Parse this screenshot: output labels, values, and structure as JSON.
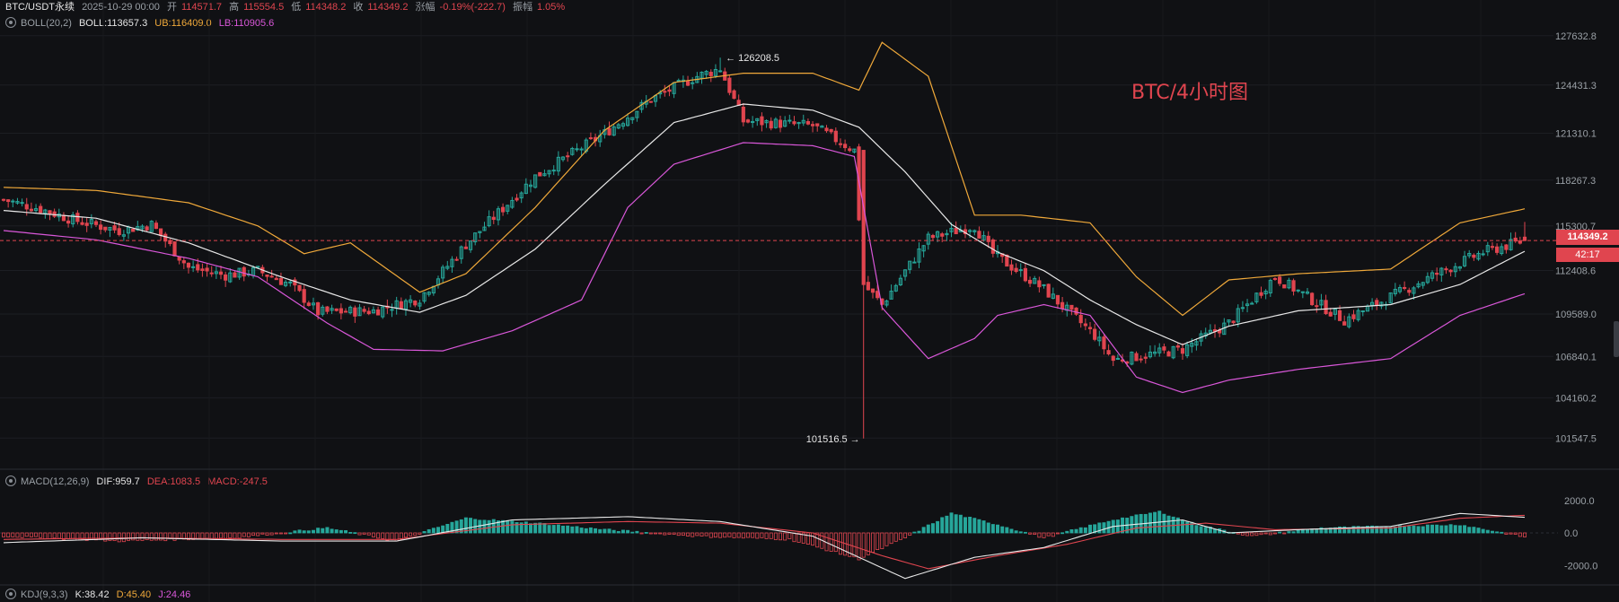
{
  "header": {
    "symbol": "BTC/USDT永续",
    "date": "2025-10-29 00:00",
    "open_label": "开",
    "open": "114571.7",
    "high_label": "高",
    "high": "115554.5",
    "low_label": "低",
    "low": "114348.2",
    "close_label": "收",
    "close": "114349.2",
    "change_label": "涨幅",
    "change": "-0.19%(-222.7)",
    "amp_label": "振幅",
    "amp": "1.05%"
  },
  "boll": {
    "name": "BOLL(20,2)",
    "mid": "BOLL:113657.3",
    "ub": "UB:116409.0",
    "lb": "LB:110905.6"
  },
  "macd": {
    "name": "MACD(12,26,9)",
    "dif": "DIF:959.7",
    "dea": "DEA:1083.5",
    "macd": "MACD:-247.5"
  },
  "kdj": {
    "name": "KDJ(9,3,3)",
    "k": "K:38.42",
    "d": "D:45.40",
    "j": "J:24.46"
  },
  "colors": {
    "up": "#26a69a",
    "down": "#e0454f",
    "mid": "#e8e8e8",
    "ub": "#f0a93a",
    "lb": "#d957d9",
    "dea": "#e0454f",
    "dif": "#e8e8e8"
  },
  "watermark": "BTC/4小时图",
  "current_price": "114349.2",
  "countdown": "42:17",
  "chart_data": [
    {
      "type": "candlestick",
      "ylim": [
        100400,
        128200
      ],
      "yticks": [
        "127632.8",
        "124431.3",
        "121310.1",
        "118267.3",
        "115300.7",
        "112408.6",
        "109589.0",
        "106840.1",
        "104160.2",
        "101547.5"
      ],
      "ytick_values": [
        127632.8,
        124431.3,
        121310.1,
        118267.3,
        115300.7,
        112408.6,
        109589.0,
        106840.1,
        104160.2,
        101547.5
      ],
      "annotations": [
        {
          "text": "126208.5",
          "value": 126208.5,
          "bar": 155
        },
        {
          "text": "101516.5",
          "value": 101516.5,
          "bar": 186
        }
      ],
      "bars": 330,
      "close_anchors": [
        [
          0,
          117000
        ],
        [
          8,
          116400
        ],
        [
          15,
          115700
        ],
        [
          25,
          115000
        ],
        [
          32,
          115400
        ],
        [
          40,
          112600
        ],
        [
          48,
          112100
        ],
        [
          55,
          112400
        ],
        [
          62,
          111500
        ],
        [
          68,
          109700
        ],
        [
          80,
          109800
        ],
        [
          90,
          110600
        ],
        [
          100,
          114100
        ],
        [
          115,
          118500
        ],
        [
          130,
          121300
        ],
        [
          140,
          123500
        ],
        [
          150,
          125000
        ],
        [
          155,
          125500
        ],
        [
          160,
          122100
        ],
        [
          175,
          121800
        ],
        [
          184,
          120200
        ],
        [
          186,
          111500
        ],
        [
          190,
          110200
        ],
        [
          200,
          114500
        ],
        [
          210,
          115300
        ],
        [
          214,
          113500
        ],
        [
          225,
          111200
        ],
        [
          236,
          108200
        ],
        [
          240,
          106600
        ],
        [
          255,
          107300
        ],
        [
          265,
          109000
        ],
        [
          275,
          112000
        ],
        [
          290,
          109200
        ],
        [
          310,
          112200
        ],
        [
          320,
          113600
        ],
        [
          329,
          114349.2
        ]
      ],
      "boll_mid_anchors": [
        [
          0,
          116300
        ],
        [
          20,
          115800
        ],
        [
          40,
          114200
        ],
        [
          60,
          112000
        ],
        [
          75,
          110500
        ],
        [
          90,
          109700
        ],
        [
          100,
          110800
        ],
        [
          115,
          113800
        ],
        [
          130,
          118000
        ],
        [
          145,
          122000
        ],
        [
          160,
          123200
        ],
        [
          175,
          122800
        ],
        [
          185,
          121700
        ],
        [
          195,
          118800
        ],
        [
          205,
          115400
        ],
        [
          215,
          113600
        ],
        [
          225,
          112400
        ],
        [
          235,
          110500
        ],
        [
          245,
          108900
        ],
        [
          255,
          107600
        ],
        [
          265,
          108800
        ],
        [
          280,
          109800
        ],
        [
          300,
          110200
        ],
        [
          315,
          111500
        ],
        [
          329,
          113657.3
        ]
      ],
      "boll_ub_anchors": [
        [
          0,
          117800
        ],
        [
          20,
          117600
        ],
        [
          40,
          116800
        ],
        [
          55,
          115300
        ],
        [
          65,
          113500
        ],
        [
          75,
          114200
        ],
        [
          90,
          111000
        ],
        [
          100,
          112200
        ],
        [
          115,
          116500
        ],
        [
          130,
          121500
        ],
        [
          145,
          124600
        ],
        [
          160,
          125200
        ],
        [
          175,
          125200
        ],
        [
          185,
          124100
        ],
        [
          190,
          127200
        ],
        [
          200,
          125000
        ],
        [
          210,
          116000
        ],
        [
          220,
          116000
        ],
        [
          235,
          115500
        ],
        [
          245,
          112000
        ],
        [
          255,
          109500
        ],
        [
          265,
          111800
        ],
        [
          280,
          112200
        ],
        [
          300,
          112500
        ],
        [
          315,
          115500
        ],
        [
          329,
          116409.0
        ]
      ],
      "boll_lb_anchors": [
        [
          0,
          115000
        ],
        [
          20,
          114400
        ],
        [
          40,
          113200
        ],
        [
          55,
          112000
        ],
        [
          70,
          109000
        ],
        [
          80,
          107300
        ],
        [
          95,
          107200
        ],
        [
          110,
          108500
        ],
        [
          125,
          110500
        ],
        [
          135,
          116500
        ],
        [
          145,
          119300
        ],
        [
          160,
          120700
        ],
        [
          175,
          120500
        ],
        [
          184,
          119800
        ],
        [
          190,
          110000
        ],
        [
          200,
          106700
        ],
        [
          210,
          108000
        ],
        [
          215,
          109500
        ],
        [
          225,
          110200
        ],
        [
          235,
          109500
        ],
        [
          245,
          105500
        ],
        [
          255,
          104500
        ],
        [
          265,
          105300
        ],
        [
          280,
          106000
        ],
        [
          300,
          106700
        ],
        [
          315,
          109500
        ],
        [
          329,
          110905.6
        ]
      ]
    },
    {
      "type": "bar",
      "name": "MACD(12,26,9)",
      "ylim": [
        -3200,
        3200
      ],
      "yticks": [
        "2000.0",
        "0.0",
        "-2000.0"
      ],
      "ytick_values": [
        2000,
        0,
        -2000
      ],
      "hist_anchors": [
        [
          0,
          -200
        ],
        [
          25,
          -500
        ],
        [
          50,
          -300
        ],
        [
          70,
          300
        ],
        [
          85,
          -500
        ],
        [
          100,
          900
        ],
        [
          115,
          600
        ],
        [
          130,
          200
        ],
        [
          150,
          -200
        ],
        [
          170,
          -400
        ],
        [
          185,
          -1600
        ],
        [
          195,
          -300
        ],
        [
          205,
          1200
        ],
        [
          215,
          500
        ],
        [
          225,
          -300
        ],
        [
          240,
          800
        ],
        [
          250,
          1300
        ],
        [
          258,
          500
        ],
        [
          270,
          -200
        ],
        [
          285,
          300
        ],
        [
          300,
          400
        ],
        [
          315,
          500
        ],
        [
          329,
          -247.5
        ]
      ],
      "dif_anchors": [
        [
          0,
          -600
        ],
        [
          30,
          -300
        ],
        [
          60,
          -500
        ],
        [
          85,
          -500
        ],
        [
          110,
          800
        ],
        [
          135,
          1000
        ],
        [
          155,
          700
        ],
        [
          175,
          -200
        ],
        [
          185,
          -1500
        ],
        [
          195,
          -2800
        ],
        [
          210,
          -1500
        ],
        [
          225,
          -900
        ],
        [
          240,
          400
        ],
        [
          255,
          800
        ],
        [
          265,
          0
        ],
        [
          280,
          200
        ],
        [
          300,
          400
        ],
        [
          315,
          1200
        ],
        [
          329,
          959.7
        ]
      ],
      "dea_anchors": [
        [
          0,
          -400
        ],
        [
          30,
          -300
        ],
        [
          60,
          -400
        ],
        [
          85,
          -400
        ],
        [
          110,
          500
        ],
        [
          135,
          700
        ],
        [
          155,
          600
        ],
        [
          175,
          0
        ],
        [
          190,
          -1400
        ],
        [
          200,
          -2200
        ],
        [
          215,
          -1400
        ],
        [
          230,
          -700
        ],
        [
          245,
          300
        ],
        [
          260,
          600
        ],
        [
          275,
          200
        ],
        [
          300,
          300
        ],
        [
          315,
          900
        ],
        [
          329,
          1083.5
        ]
      ]
    }
  ]
}
